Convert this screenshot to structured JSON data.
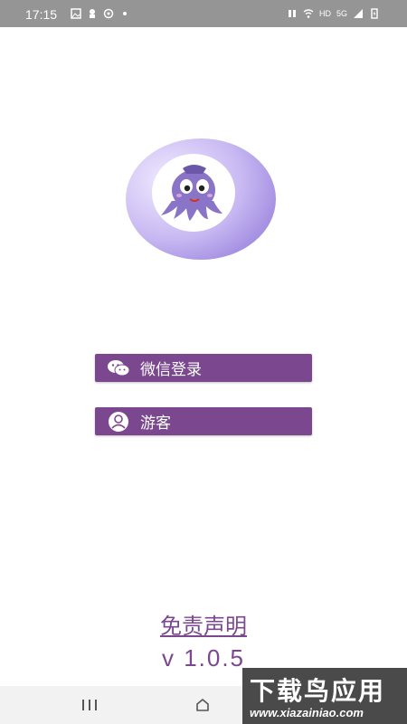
{
  "status_bar": {
    "time": "17:15",
    "left_icons": [
      "image-icon",
      "hand-icon",
      "sync-icon",
      "dot-icon"
    ],
    "right_icons": [
      "mute-icon",
      "wifi-icon",
      "hd-icon",
      "signal-icon",
      "battery-charging-icon"
    ],
    "hd_label": "HD",
    "network_label": "5G"
  },
  "logo": {
    "description_icon": "octopus-logo-icon",
    "colors": {
      "ring": "#b9a6ee",
      "inner": "#ffffff",
      "octopus": "#8a74c8"
    }
  },
  "buttons": {
    "wechat_login": {
      "label": "微信登录",
      "icon": "wechat-icon"
    },
    "guest": {
      "label": "游客",
      "icon": "user-icon"
    }
  },
  "disclaimer": "免责声明",
  "version": "v 1.0.5",
  "nav_bar": {
    "icons": [
      "recents-icon",
      "home-icon"
    ]
  },
  "watermark": {
    "title": "下载鸟应用",
    "url": "www.xiazainiao.com"
  },
  "colors": {
    "accent": "#7b4890",
    "status_bar": "#959595",
    "nav_bar": "#f2f2f2"
  }
}
